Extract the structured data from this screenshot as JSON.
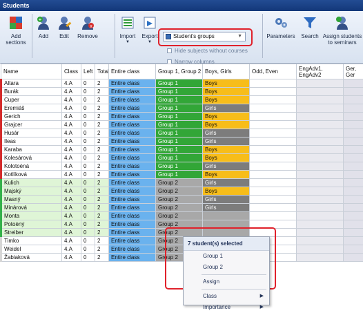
{
  "window": {
    "title": "Students"
  },
  "ribbon": {
    "add_sections": "Add sections",
    "add": "Add",
    "edit": "Edit",
    "remove": "Remove",
    "import": "Import",
    "export": "Export",
    "groups_select": "Student's groups",
    "hide_subjects": "Hide subjects without courses",
    "narrow_columns": "Narrow columns",
    "parameters": "Parameters",
    "search": "Search",
    "assign_seminars": "Assign students to seminars"
  },
  "table": {
    "columns": [
      "Name",
      "Class",
      "Left",
      "Total",
      "Entire class",
      "Group 1, Group 2",
      "Boys, Girls",
      "Odd, Even",
      "EngAdv1, EngAdv2",
      "Ger, Ger"
    ],
    "rows": [
      {
        "name": "Altara",
        "class": "4.A",
        "left": "0",
        "total": "2",
        "entire": "Entire class",
        "group": "Group 1",
        "sex": "Boys",
        "mark": "red"
      },
      {
        "name": "Burák",
        "class": "4.A",
        "left": "0",
        "total": "2",
        "entire": "Entire class",
        "group": "Group 1",
        "sex": "Boys",
        "mark": "red"
      },
      {
        "name": "Cuper",
        "class": "4.A",
        "left": "0",
        "total": "2",
        "entire": "Entire class",
        "group": "Group 1",
        "sex": "Boys",
        "mark": "red"
      },
      {
        "name": "Eremiáš",
        "class": "4.A",
        "left": "0",
        "total": "2",
        "entire": "Entire class",
        "group": "Group 1",
        "sex": "Girls",
        "mark": "red"
      },
      {
        "name": "Gerich",
        "class": "4.A",
        "left": "0",
        "total": "2",
        "entire": "Entire class",
        "group": "Group 1",
        "sex": "Boys",
        "mark": "red"
      },
      {
        "name": "Grajcer",
        "class": "4.A",
        "left": "0",
        "total": "2",
        "entire": "Entire class",
        "group": "Group 1",
        "sex": "Boys",
        "mark": "red"
      },
      {
        "name": "Husár",
        "class": "4.A",
        "left": "0",
        "total": "2",
        "entire": "Entire class",
        "group": "Group 1",
        "sex": "Girls",
        "mark": "red"
      },
      {
        "name": "Ileas",
        "class": "4.A",
        "left": "0",
        "total": "2",
        "entire": "Entire class",
        "group": "Group 1",
        "sex": "Girls",
        "mark": "red"
      },
      {
        "name": "Karaba",
        "class": "4.A",
        "left": "0",
        "total": "2",
        "entire": "Entire class",
        "group": "Group 1",
        "sex": "Boys",
        "mark": "red"
      },
      {
        "name": "Kolesárová",
        "class": "4.A",
        "left": "0",
        "total": "2",
        "entire": "Entire class",
        "group": "Group 1",
        "sex": "Boys",
        "mark": "red"
      },
      {
        "name": "Kolotoèná",
        "class": "4.A",
        "left": "0",
        "total": "2",
        "entire": "Entire class",
        "group": "Group 1",
        "sex": "Girls",
        "mark": "red"
      },
      {
        "name": "Kotlíková",
        "class": "4.A",
        "left": "0",
        "total": "2",
        "entire": "Entire class",
        "group": "Group 1",
        "sex": "Boys",
        "mark": "red"
      },
      {
        "name": "Kulich",
        "class": "4.A",
        "left": "0",
        "total": "2",
        "entire": "Entire class",
        "group": "Group 2",
        "sex": "Girls",
        "mark": "green"
      },
      {
        "name": "Majský",
        "class": "4.A",
        "left": "0",
        "total": "2",
        "entire": "Entire class",
        "group": "Group 2",
        "sex": "Boys",
        "mark": "green"
      },
      {
        "name": "Masný",
        "class": "4.A",
        "left": "0",
        "total": "2",
        "entire": "Entire class",
        "group": "Group 2",
        "sex": "Girls",
        "mark": "green"
      },
      {
        "name": "Minárová",
        "class": "4.A",
        "left": "0",
        "total": "2",
        "entire": "Entire class",
        "group": "Group 2",
        "sex": "Girls",
        "mark": "green"
      },
      {
        "name": "Monta",
        "class": "4.A",
        "left": "0",
        "total": "2",
        "entire": "Entire class",
        "group": "Group 2",
        "sex": "",
        "mark": "green"
      },
      {
        "name": "Potoèný",
        "class": "4.A",
        "left": "0",
        "total": "2",
        "entire": "Entire class",
        "group": "Group 2",
        "sex": "",
        "mark": "green"
      },
      {
        "name": "Streiber",
        "class": "4.A",
        "left": "0",
        "total": "2",
        "entire": "Entire class",
        "group": "Group 2",
        "sex": "",
        "mark": "green"
      },
      {
        "name": "Timko",
        "class": "4.A",
        "left": "0",
        "total": "2",
        "entire": "Entire class",
        "group": "Group 2",
        "sex": "",
        "mark": "plain"
      },
      {
        "name": "Weidel",
        "class": "4.A",
        "left": "0",
        "total": "2",
        "entire": "Entire class",
        "group": "Group 2",
        "sex": "",
        "mark": "plain"
      },
      {
        "name": "Žabiaková",
        "class": "4.A",
        "left": "0",
        "total": "2",
        "entire": "Entire class",
        "group": "Group 2",
        "sex": "",
        "mark": "plain"
      }
    ]
  },
  "context_menu": {
    "header": "7 student(s) selected",
    "group1": "Group 1",
    "group2": "Group 2",
    "assign": "Assign",
    "class": "Class",
    "importance": "Importance"
  },
  "colors": {
    "entire": "#6ab2ee",
    "group1": "#32a637",
    "group2": "#a8a8a8",
    "boys": "#f7bd1a",
    "girls": "#7c7c7c",
    "highlight": "#e0212b"
  }
}
